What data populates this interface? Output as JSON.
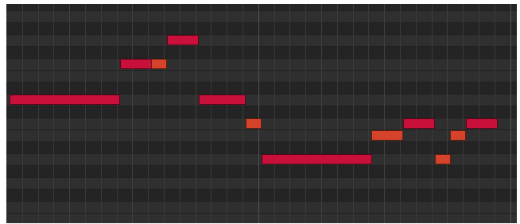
{
  "app": "piano-roll",
  "colors": {
    "grid_background": "#2c2c2c",
    "white_key_row": "#2f2f2f",
    "black_key_row": "#242424",
    "note_primary": "#c8103a",
    "note_secondary": "#d5442a",
    "bar_line": "#525252"
  },
  "notes": [
    {
      "row": 3,
      "start": 10,
      "length": 2,
      "color": "primary"
    },
    {
      "row": 5,
      "start": 7,
      "length": 2,
      "color": "primary"
    },
    {
      "row": 5,
      "start": 9,
      "length": 1,
      "color": "secondary"
    },
    {
      "row": 8,
      "start": 0,
      "length": 7,
      "color": "primary"
    },
    {
      "row": 8,
      "start": 12,
      "length": 3,
      "color": "primary"
    },
    {
      "row": 10,
      "start": 15,
      "length": 1,
      "color": "secondary"
    },
    {
      "row": 10,
      "start": 25,
      "length": 2,
      "color": "primary"
    },
    {
      "row": 10,
      "start": 29,
      "length": 2,
      "color": "primary"
    },
    {
      "row": 11,
      "start": 23,
      "length": 2,
      "color": "secondary"
    },
    {
      "row": 11,
      "start": 28,
      "length": 1,
      "color": "secondary"
    },
    {
      "row": 13,
      "start": 16,
      "length": 7,
      "color": "primary"
    },
    {
      "row": 13,
      "start": 27,
      "length": 1,
      "color": "secondary"
    }
  ]
}
